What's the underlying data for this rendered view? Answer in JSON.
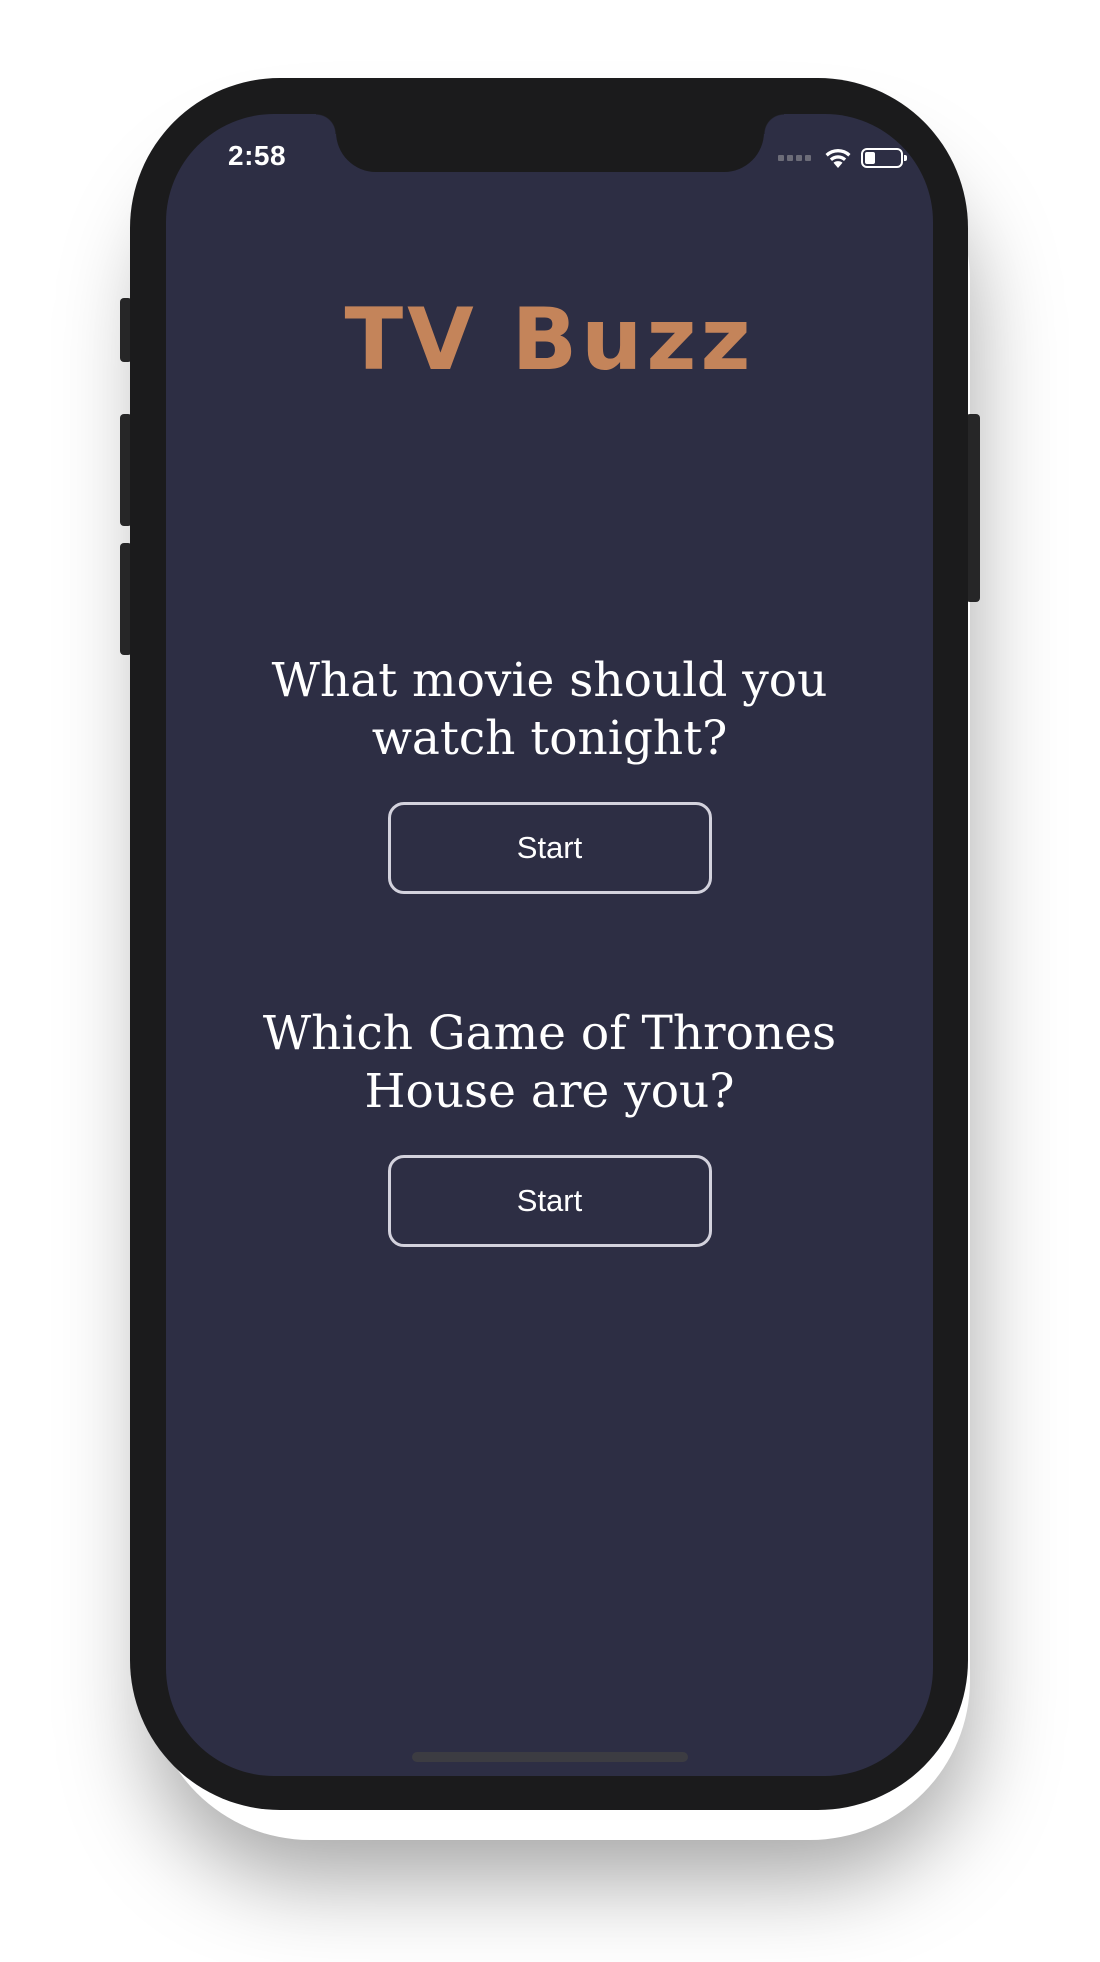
{
  "status_bar": {
    "time": "2:58",
    "icons": [
      "cellular-signal-icon",
      "wifi-icon",
      "battery-icon"
    ],
    "battery_level": 0.3
  },
  "app": {
    "title": "TV Buzz"
  },
  "quizzes": [
    {
      "question": "What movie should you watch tonight?",
      "button_label": "Start"
    },
    {
      "question": "Which Game of Thrones House are you?",
      "button_label": "Start"
    }
  ],
  "colors": {
    "background": "#2d2e44",
    "title_accent": "#c4845a",
    "text": "#ffffff",
    "button_border": "#d3d2dd",
    "device_frame": "#1b1b1c"
  }
}
